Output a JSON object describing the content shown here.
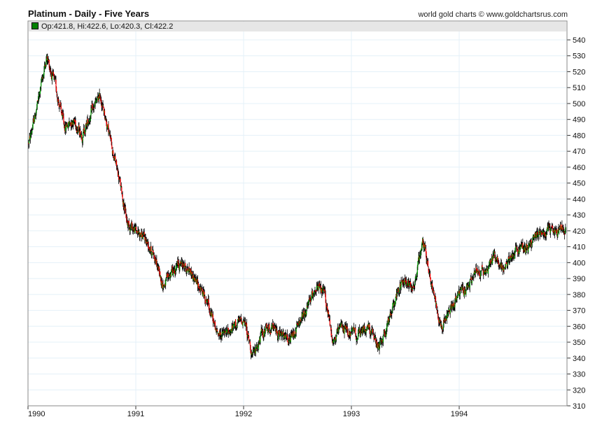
{
  "header": {
    "title": "Platinum - Daily - Five Years",
    "credit": "world gold charts © www.goldchartsrus.com"
  },
  "legend": {
    "text": "Op:421.8, Hi:422.6, Lo:420.3, Cl:422.2",
    "up_color": "#008000"
  },
  "colors": {
    "up": "#00a000",
    "down": "#ff0000",
    "wick": "#000000",
    "grid": "#e4f0f8",
    "axis": "#888888"
  },
  "chart_data": {
    "type": "candlestick",
    "title": "Platinum - Daily - Five Years",
    "xlabel": "",
    "ylabel": "",
    "ylim": [
      310,
      545
    ],
    "yticks": [
      310,
      320,
      330,
      340,
      350,
      360,
      370,
      380,
      390,
      400,
      410,
      420,
      430,
      440,
      450,
      460,
      470,
      480,
      490,
      500,
      510,
      520,
      530,
      540
    ],
    "xticks": [
      "1990",
      "1991",
      "1992",
      "1993",
      "1994"
    ],
    "grid": true,
    "start_value": 475,
    "monthly_closes_note": "approximate month-end closes Jan 1990 - Dec 1994",
    "monthly_closes": [
      500,
      530,
      510,
      485,
      490,
      480,
      495,
      505,
      480,
      455,
      425,
      420,
      415,
      405,
      385,
      395,
      400,
      395,
      385,
      375,
      355,
      355,
      360,
      365,
      340,
      355,
      360,
      355,
      350,
      360,
      370,
      385,
      380,
      350,
      360,
      355,
      355,
      360,
      345,
      360,
      380,
      390,
      385,
      415,
      385,
      360,
      370,
      380,
      385,
      395,
      395,
      405,
      395,
      405,
      410,
      410,
      420,
      420,
      420,
      422.2
    ],
    "last_bar": {
      "open": 421.8,
      "high": 422.6,
      "low": 420.3,
      "close": 422.2
    }
  }
}
